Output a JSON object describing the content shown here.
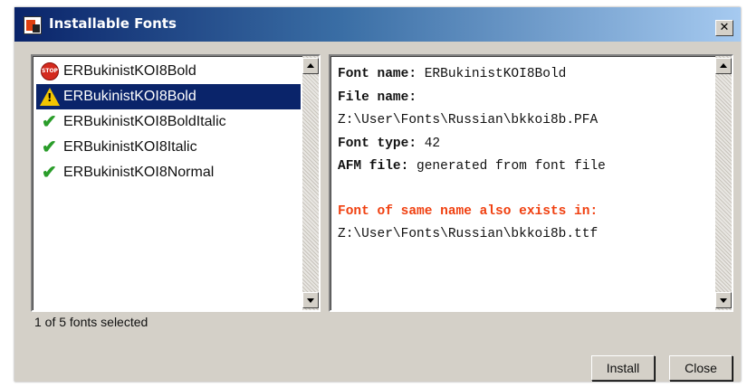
{
  "window": {
    "title": "Installable Fonts",
    "close_glyph": "✕"
  },
  "font_list": {
    "items": [
      {
        "label": "ERBukinistKOI8Bold",
        "icon": "stop-icon",
        "status": "error",
        "selected": false
      },
      {
        "label": "ERBukinistKOI8Bold",
        "icon": "warning-icon",
        "status": "warning",
        "selected": true
      },
      {
        "label": "ERBukinistKOI8BoldItalic",
        "icon": "check-icon",
        "status": "ok",
        "selected": false
      },
      {
        "label": "ERBukinistKOI8Italic",
        "icon": "check-icon",
        "status": "ok",
        "selected": false
      },
      {
        "label": "ERBukinistKOI8Normal",
        "icon": "check-icon",
        "status": "ok",
        "selected": false
      }
    ],
    "stop_text": "STOP",
    "warn_text": "!"
  },
  "details": {
    "font_name_label": "Font name:",
    "font_name_value": "ERBukinistKOI8Bold",
    "file_name_label": "File name:",
    "file_path": "Z:\\User\\Fonts\\Russian\\bkkoi8b.PFA",
    "font_type_label": "Font type:",
    "font_type_value": "42",
    "afm_label": "AFM file:",
    "afm_value": "generated from font file",
    "conflict_text": "Font of same name also exists in:",
    "conflict_path": "Z:\\User\\Fonts\\Russian\\bkkoi8b.ttf"
  },
  "status_text": "1 of 5 fonts selected",
  "buttons": {
    "install": "Install",
    "close": "Close"
  },
  "colors": {
    "selection": "#0a246a",
    "warning_text": "#f04010",
    "check": "#2a9d2a",
    "stop": "#d42a1e"
  }
}
